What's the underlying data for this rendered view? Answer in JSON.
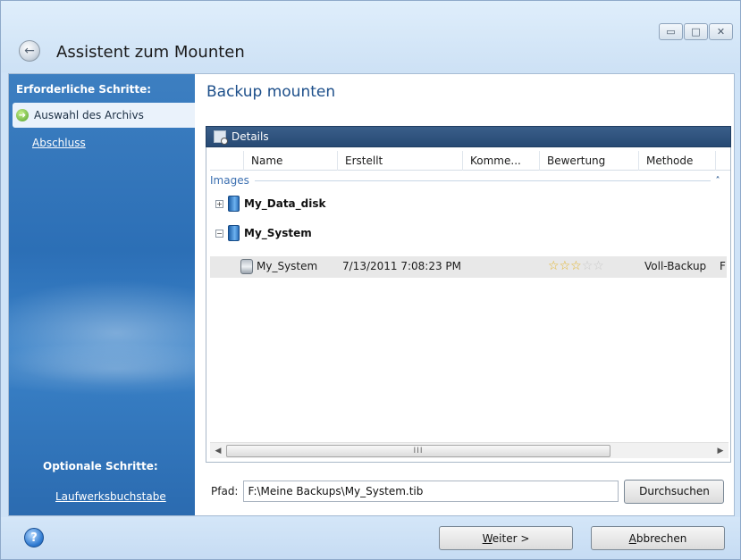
{
  "window": {
    "title": "Assistent zum Mounten",
    "controls": {
      "minimize": "▭",
      "maximize": "□",
      "close": "✕"
    }
  },
  "sidebar": {
    "required_heading": "Erforderliche Schritte:",
    "steps": [
      {
        "label": "Auswahl des Archivs",
        "current": true
      },
      {
        "label": "Abschluss",
        "current": false
      }
    ],
    "optional_heading": "Optionale Schritte:",
    "optional_steps": [
      {
        "label": "Laufwerksbuchstabe"
      }
    ]
  },
  "main": {
    "title": "Backup mounten",
    "details_label": "Details",
    "columns": [
      "Name",
      "Erstellt",
      "Komme...",
      "Bewertung",
      "Methode"
    ],
    "group": {
      "label": "Images",
      "chevron": "˄"
    },
    "tree": [
      {
        "label": "My_Data_disk",
        "expander": "+",
        "expanded": false
      },
      {
        "label": "My_System",
        "expander": "−",
        "expanded": true
      }
    ],
    "backup_row": {
      "name": "My_System",
      "created": "7/13/2011 7:08:23 PM",
      "rating": 3,
      "rating_max": 5,
      "method": "Voll-Backup",
      "extra": "F"
    },
    "scrollbar": {
      "left": "◀",
      "right": "▶",
      "grip": "III"
    },
    "path": {
      "label": "Pfad:",
      "value": "F:\\Meine Backups\\My_System.tib",
      "browse_label": "Durchsuchen"
    }
  },
  "footer": {
    "help_label": "?",
    "next_label": "Weiter >",
    "cancel_label": "Abbrechen"
  },
  "colors": {
    "sidebar": "#2c6fb6",
    "title_text": "#1d4f8a",
    "details_bar": "#2b4d77",
    "star_on": "#e3b325",
    "star_off": "#c9c9c9"
  },
  "icons": {
    "back": "back-arrow-icon",
    "current_step": "green-arrow-icon",
    "details": "magnifier-icon",
    "disk": "disk-icon",
    "backup": "backup-archive-icon",
    "help": "help-icon"
  }
}
